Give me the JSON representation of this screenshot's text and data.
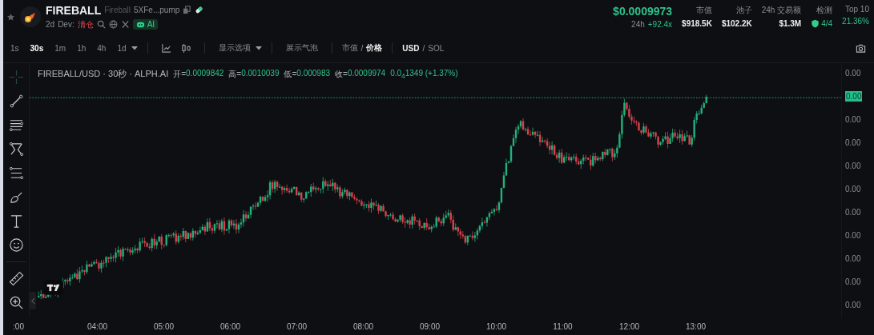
{
  "header": {
    "symbol": "FIREBALL",
    "name": "Fireball",
    "address": "5XFe...pump",
    "age": "2d",
    "dev_label": "Dev:",
    "dev_status": "清仓",
    "ai_badge": "AI",
    "price": "$0.0009973",
    "change_label": "24h",
    "change": "+92.4x",
    "stats": [
      {
        "label": "市值",
        "value": "$918.5K",
        "kind": "plain"
      },
      {
        "label": "池子",
        "value": "$102.2K",
        "kind": "plain"
      },
      {
        "label": "24h 交易额",
        "value": "$1.3M",
        "kind": "plain"
      },
      {
        "label": "检测",
        "value": "4/4",
        "kind": "check"
      },
      {
        "label": "Top 10",
        "value": "21.36%",
        "kind": "percent"
      }
    ]
  },
  "toolbar": {
    "intervals": [
      {
        "label": "1s",
        "selected": false
      },
      {
        "label": "30s",
        "selected": true
      },
      {
        "label": "1m",
        "selected": false
      },
      {
        "label": "1h",
        "selected": false
      },
      {
        "label": "4h",
        "selected": false
      },
      {
        "label": "1d",
        "selected": false
      }
    ],
    "display_options": "显示选项",
    "bubbles": "展示气泡",
    "mode_toggle": {
      "separator": "/",
      "options": [
        {
          "label": "市值",
          "selected": false
        },
        {
          "label": "价格",
          "selected": true
        }
      ]
    },
    "currency_toggle": {
      "separator": "/",
      "options": [
        {
          "label": "USD",
          "selected": true
        },
        {
          "label": "SOL",
          "selected": false
        }
      ]
    }
  },
  "legend": {
    "title": "FIREBALL/USD · 30秒 · ALPH.AI",
    "ohlc": [
      {
        "label": "开=",
        "value": "0.0009842"
      },
      {
        "label": "高=",
        "value": "0.0010039"
      },
      {
        "label": "低=",
        "value": "0.000983"
      },
      {
        "label": "收=",
        "value": "0.0009974"
      }
    ],
    "change": "0.0$_{4}$1349 (+1.37%)"
  },
  "price_axis": [
    {
      "label": "0.00",
      "kind": "tick"
    },
    {
      "label": "0.00",
      "kind": "current"
    },
    {
      "label": "0.00",
      "kind": "tick"
    },
    {
      "label": "0.00",
      "kind": "tick"
    },
    {
      "label": "0.00",
      "kind": "tick"
    },
    {
      "label": "0.00",
      "kind": "tick"
    },
    {
      "label": "0.00",
      "kind": "tick"
    },
    {
      "label": "0.00",
      "kind": "tick"
    },
    {
      "label": "0.00",
      "kind": "tick"
    },
    {
      "label": "0.00",
      "kind": "tick"
    },
    {
      "label": "0.00",
      "kind": "tick"
    }
  ],
  "time_axis": [
    ":00",
    "04:00",
    "05:00",
    "06:00",
    "07:00",
    "08:00",
    "09:00",
    "10:00",
    "11:00",
    "12:00",
    "13:00"
  ]
}
